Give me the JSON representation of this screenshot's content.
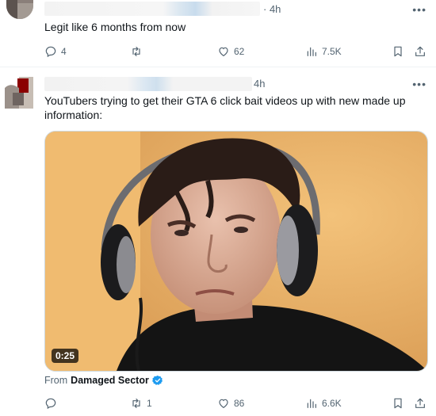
{
  "tweet1": {
    "time": "4h",
    "text": "Legit like 6 months from now",
    "more_icon": "more-horizontal-icon",
    "replies": "4",
    "retweets": "",
    "likes": "62",
    "views": "7.5K"
  },
  "tweet2": {
    "time": "4h",
    "text": "YouTubers trying to get their GTA 6 click bait videos up with new made up information:",
    "more_icon": "more-horizontal-icon",
    "video_duration": "0:25",
    "from_label": "From",
    "from_source": "Damaged Sector",
    "replies": "",
    "retweets": "1",
    "likes": "86",
    "views": "6.6K"
  },
  "colors": {
    "text_secondary": "#536471",
    "verified_blue": "#1d9bf0",
    "border": "#eff3f4"
  }
}
